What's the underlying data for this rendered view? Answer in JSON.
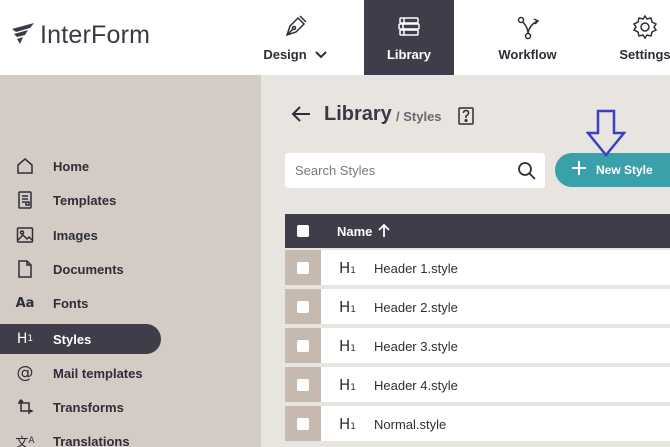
{
  "app": {
    "brand": "InterForm"
  },
  "nav": {
    "design": "Design",
    "library": "Library",
    "workflow": "Workflow",
    "settings": "Settings"
  },
  "sidebar": {
    "items": [
      {
        "label": "Home",
        "icon": "home-icon"
      },
      {
        "label": "Templates",
        "icon": "template-icon"
      },
      {
        "label": "Images",
        "icon": "image-icon"
      },
      {
        "label": "Documents",
        "icon": "document-icon"
      },
      {
        "label": "Fonts",
        "icon": "font-icon"
      },
      {
        "label": "Styles",
        "icon": "heading-icon",
        "active": true
      },
      {
        "label": "Mail templates",
        "icon": "at-icon"
      },
      {
        "label": "Transforms",
        "icon": "transform-icon"
      },
      {
        "label": "Translations",
        "icon": "translate-icon"
      }
    ]
  },
  "main": {
    "title": "Library",
    "crumb": "/ Styles",
    "search_placeholder": "Search Styles",
    "new_button": "New Style",
    "table": {
      "header_name": "Name",
      "rows": [
        "Header 1.style",
        "Header 2.style",
        "Header 3.style",
        "Header 4.style",
        "Normal.style"
      ]
    }
  },
  "colors": {
    "accent": "#3aa1aa",
    "dark": "#3f3d4a",
    "sidebar": "#d3cbc4",
    "background": "#e8e4df",
    "annotation_arrow": "#3a3fc4"
  }
}
